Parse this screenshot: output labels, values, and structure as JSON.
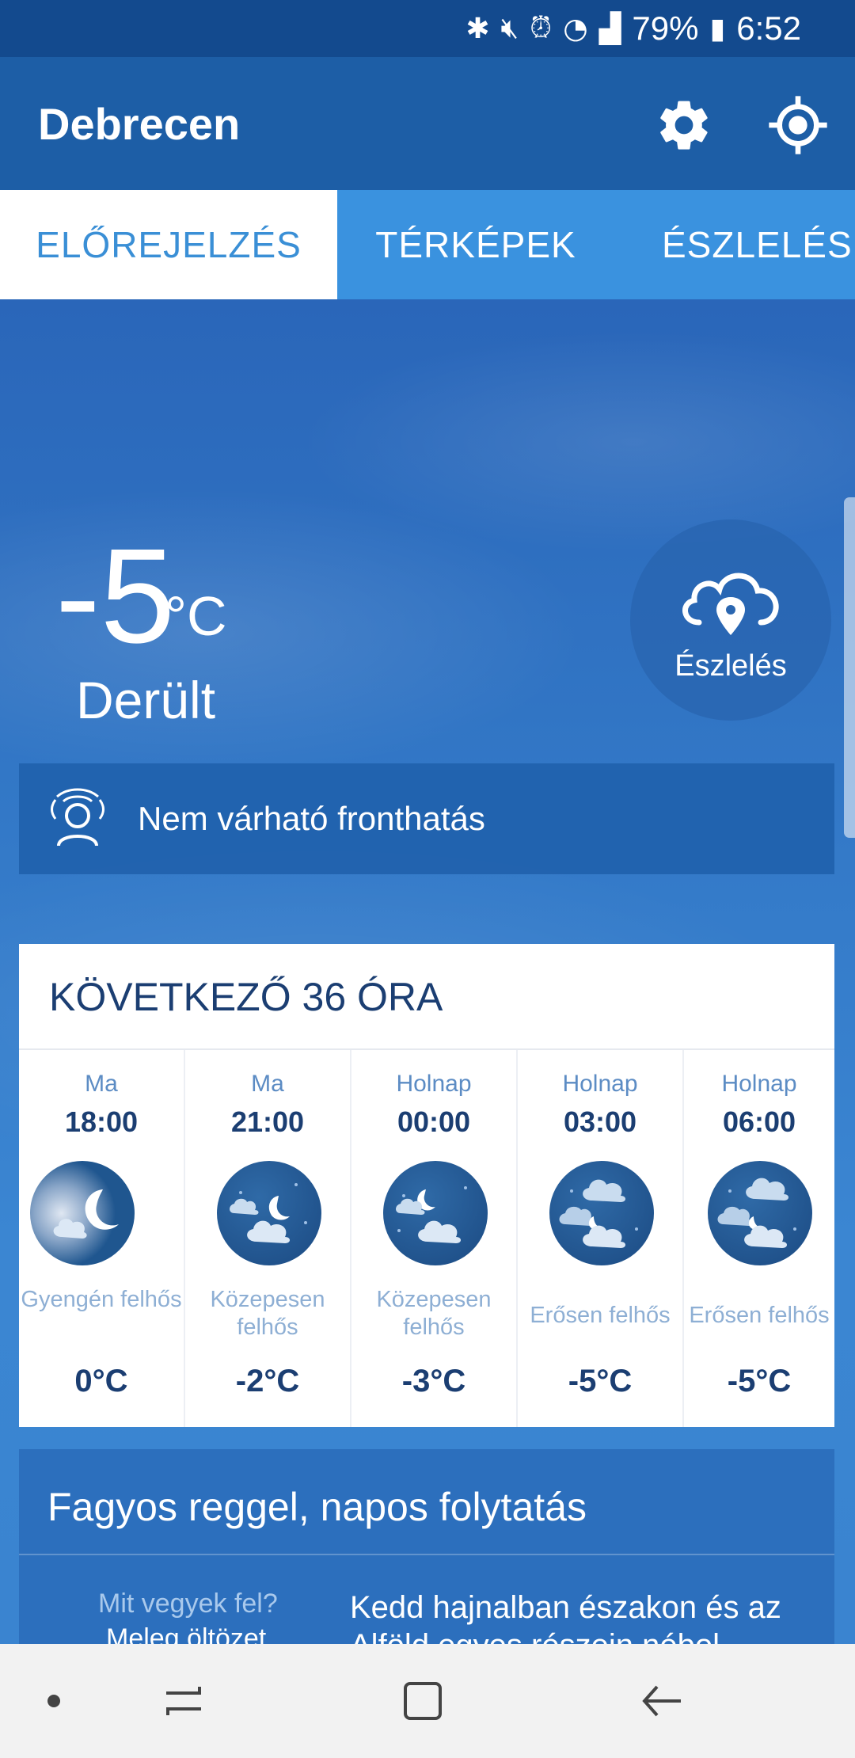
{
  "status_bar": {
    "battery": "79%",
    "time": "6:52"
  },
  "header": {
    "title": "Debrecen"
  },
  "tabs": [
    {
      "label": "ELŐREJELZÉS",
      "active": true
    },
    {
      "label": "TÉRKÉPEK",
      "active": false
    },
    {
      "label": "ÉSZLELÉS",
      "active": false
    }
  ],
  "current": {
    "temperature": "-5",
    "unit": "°C",
    "condition": "Derült",
    "observation_button": "Észlelés"
  },
  "front": {
    "text": "Nem várható fronthatás"
  },
  "forecast": {
    "title": "KÖVETKEZŐ 36 ÓRA",
    "items": [
      {
        "day": "Ma",
        "time": "18:00",
        "desc": "Gyengén felhős",
        "temp": "0°C",
        "icon": "moon-cloud-icon"
      },
      {
        "day": "Ma",
        "time": "21:00",
        "desc": "Közepesen felhős",
        "temp": "-2°C",
        "icon": "moon-cloud-icon"
      },
      {
        "day": "Holnap",
        "time": "00:00",
        "desc": "Közepesen felhős",
        "temp": "-3°C",
        "icon": "moon-cloud-icon"
      },
      {
        "day": "Holnap",
        "time": "03:00",
        "desc": "Erősen felhős",
        "temp": "-5°C",
        "icon": "heavy-cloud-night-icon"
      },
      {
        "day": "Holnap",
        "time": "06:00",
        "desc": "Erősen felhős",
        "temp": "-5°C",
        "icon": "heavy-cloud-night-icon"
      }
    ]
  },
  "text_forecast": {
    "title": "Fagyos reggel, napos folytatás",
    "question": "Mit vegyek fel?",
    "answer": "Meleg öltözet",
    "body": "Kedd hajnalban északon és az Alföld egyes részein nébol"
  },
  "colors": {
    "status_bar": "#134a8e",
    "app_bar": "#1d5ea6",
    "tab_bar": "#3a92df",
    "accent": "#3a8fd6",
    "dark_text": "#1b3e72"
  }
}
